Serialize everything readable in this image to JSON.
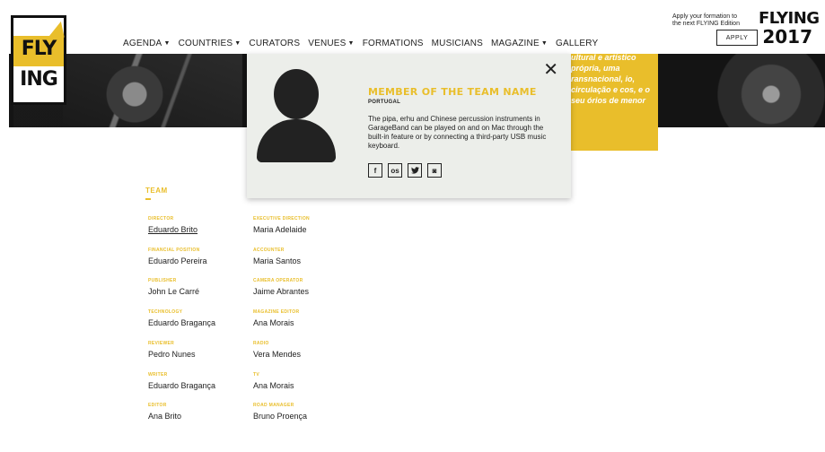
{
  "brand": {
    "logo_line1": "FLY",
    "logo_line2": "ING",
    "accent_color": "#e9be2b",
    "edition_line1": "FLYING",
    "edition_line2": "2017"
  },
  "nav": [
    {
      "label": "AGENDA",
      "dropdown": true
    },
    {
      "label": "COUNTRIES",
      "dropdown": true
    },
    {
      "label": "CURATORS",
      "dropdown": false
    },
    {
      "label": "VENUES",
      "dropdown": true
    },
    {
      "label": "FORMATIONS",
      "dropdown": false
    },
    {
      "label": "MUSICIANS",
      "dropdown": false
    },
    {
      "label": "MAGAZINE",
      "dropdown": true
    },
    {
      "label": "GALLERY",
      "dropdown": false
    }
  ],
  "apply": {
    "text": "Apply your formation to the next FLYING Edition",
    "button": "APPLY"
  },
  "hero": {
    "yellow_text": "ultural e artístico própria, uma ransnacional, io, circulação e cos, e o seu órios de menor"
  },
  "modal": {
    "close_icon": "close-icon",
    "name": "MEMBER OF THE TEAM NAME",
    "country": "PORTUGAL",
    "description": "The pipa, erhu and Chinese percussion instruments in GarageBand can be played on and on Mac through the built-in feature or by connecting a third-party USB music keyboard.",
    "socials": [
      {
        "icon": "facebook-icon",
        "glyph": "f"
      },
      {
        "icon": "lastfm-icon",
        "glyph": "os"
      },
      {
        "icon": "twitter-icon",
        "glyph": "t"
      },
      {
        "icon": "instagram-icon",
        "glyph": "◙"
      }
    ]
  },
  "team": {
    "title": "TEAM",
    "members": [
      {
        "role": "DIRECTOR",
        "name": "Eduardo Brito"
      },
      {
        "role": "EXECUTIVE DIRECTION",
        "name": "Maria Adelaide"
      },
      {
        "role": "FINANCIAL POSITION",
        "name": "Eduardo Pereira"
      },
      {
        "role": "ACCOUNTER",
        "name": "Maria Santos"
      },
      {
        "role": "PUBLISHER",
        "name": "John Le Carré"
      },
      {
        "role": "CAMERA OPERATOR",
        "name": "Jaime Abrantes"
      },
      {
        "role": "TECHNOLOGY",
        "name": "Eduardo Bragança"
      },
      {
        "role": "MAGAZINE EDITOR",
        "name": "Ana Morais"
      },
      {
        "role": "REVIEWER",
        "name": "Pedro Nunes"
      },
      {
        "role": "RADIO",
        "name": "Vera Mendes"
      },
      {
        "role": "WRITER",
        "name": "Eduardo Bragança"
      },
      {
        "role": "TV",
        "name": "Ana Morais"
      },
      {
        "role": "EDITOR",
        "name": "Ana Brito"
      },
      {
        "role": "ROAD MANAGER",
        "name": "Bruno Proença"
      }
    ]
  }
}
